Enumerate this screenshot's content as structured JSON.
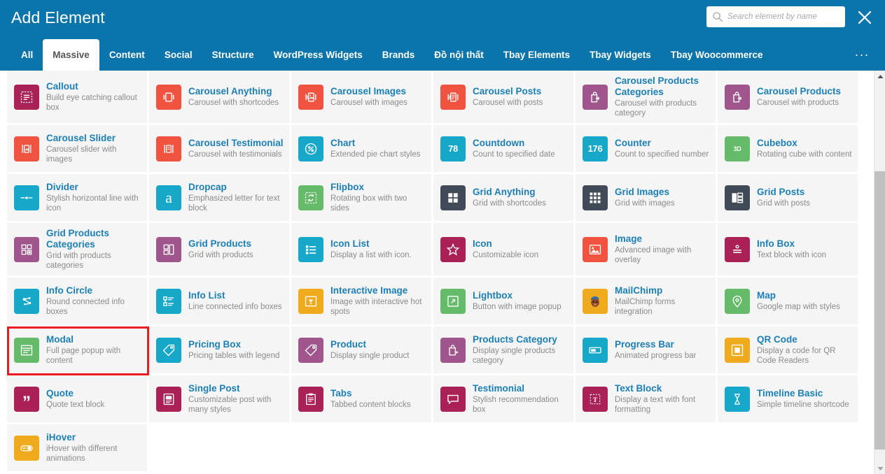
{
  "header": {
    "title": "Add Element",
    "search": {
      "placeholder": "Search element by name",
      "value": "",
      "icon": "search-icon"
    },
    "close_icon": "close-icon"
  },
  "tabs": {
    "items": [
      {
        "label": "All",
        "active": false
      },
      {
        "label": "Massive",
        "active": true
      },
      {
        "label": "Content",
        "active": false
      },
      {
        "label": "Social",
        "active": false
      },
      {
        "label": "Structure",
        "active": false
      },
      {
        "label": "WordPress Widgets",
        "active": false
      },
      {
        "label": "Brands",
        "active": false
      },
      {
        "label": "Đồ nội thất",
        "active": false
      },
      {
        "label": "Tbay Elements",
        "active": false
      },
      {
        "label": "Tbay Widgets",
        "active": false
      },
      {
        "label": "Tbay Woocommerce",
        "active": false
      }
    ],
    "more_label": "..."
  },
  "colors": {
    "header_blue": "#0a74ab",
    "title_blue": "#1c7fb5",
    "selection_red": "#ec1c24",
    "cell_bg": "#f5f5f5",
    "magenta": "#aa2255",
    "purple": "#a0558c",
    "red": "#f05340",
    "cyan": "#16a7c9",
    "green": "#66bb6a",
    "darkslate": "#414b57",
    "orange": "#efab1d"
  },
  "elements": [
    {
      "title": "Callout",
      "desc": "Build eye catching callout box",
      "icon": "callout-icon",
      "color": "#aa2255",
      "selected": false
    },
    {
      "title": "Carousel Anything",
      "desc": "Carousel with shortcodes",
      "icon": "carousel-anything-icon",
      "color": "#f05340",
      "selected": false
    },
    {
      "title": "Carousel Images",
      "desc": "Carousel with images",
      "icon": "carousel-images-icon",
      "color": "#f05340",
      "selected": false
    },
    {
      "title": "Carousel Posts",
      "desc": "Carousel with posts",
      "icon": "carousel-posts-icon",
      "color": "#f05340",
      "selected": false
    },
    {
      "title": "Carousel Products Categories",
      "desc": "Carousel with products category",
      "icon": "bag-arrow-icon",
      "color": "#a0558c",
      "selected": false
    },
    {
      "title": "Carousel Products",
      "desc": "Carousel with products",
      "icon": "bag-arrow-icon",
      "color": "#a0558c",
      "selected": false
    },
    {
      "title": "Carousel Slider",
      "desc": "Carousel slider with images",
      "icon": "carousel-slider-icon",
      "color": "#f05340",
      "selected": false
    },
    {
      "title": "Carousel Testimonial",
      "desc": "Carousel with testimonials",
      "icon": "carousel-testimonial-icon",
      "color": "#f05340",
      "selected": false
    },
    {
      "title": "Chart",
      "desc": "Extended pie chart styles",
      "icon": "pie-chart-icon",
      "color": "#16a7c9",
      "selected": false
    },
    {
      "title": "Countdown",
      "desc": "Count to specified date",
      "icon": "countdown-icon",
      "color": "#16a7c9",
      "badge": "78",
      "selected": false
    },
    {
      "title": "Counter",
      "desc": "Count to specified number",
      "icon": "counter-icon",
      "color": "#16a7c9",
      "badge": "176",
      "selected": false
    },
    {
      "title": "Cubebox",
      "desc": "Rotating cube with content",
      "icon": "cube-3d-icon",
      "color": "#66bb6a",
      "badge": "3D",
      "selected": false
    },
    {
      "title": "Divider",
      "desc": "Stylish horizontal line with icon",
      "icon": "divider-icon",
      "color": "#16a7c9",
      "selected": false
    },
    {
      "title": "Dropcap",
      "desc": "Emphasized letter for text block",
      "icon": "dropcap-icon",
      "color": "#16a7c9",
      "badge": "a",
      "selected": false
    },
    {
      "title": "Flipbox",
      "desc": "Rotating box with two sides",
      "icon": "flipbox-icon",
      "color": "#66bb6a",
      "selected": false
    },
    {
      "title": "Grid Anything",
      "desc": "Grid with shortcodes",
      "icon": "grid-anything-icon",
      "color": "#414b57",
      "selected": false
    },
    {
      "title": "Grid Images",
      "desc": "Grid with images",
      "icon": "grid-images-icon",
      "color": "#414b57",
      "selected": false
    },
    {
      "title": "Grid Posts",
      "desc": "Grid with posts",
      "icon": "grid-posts-icon",
      "color": "#414b57",
      "selected": false
    },
    {
      "title": "Grid Products Categories",
      "desc": "Grid with products categories",
      "icon": "grid-products-categories-icon",
      "color": "#a0558c",
      "selected": false
    },
    {
      "title": "Grid Products",
      "desc": "Grid with products",
      "icon": "grid-products-icon",
      "color": "#a0558c",
      "selected": false
    },
    {
      "title": "Icon List",
      "desc": "Display a list with icon.",
      "icon": "icon-list-icon",
      "color": "#16a7c9",
      "selected": false
    },
    {
      "title": "Icon",
      "desc": "Customizable icon",
      "icon": "star-icon",
      "color": "#aa2255",
      "selected": false
    },
    {
      "title": "Image",
      "desc": "Advanced image with overlay",
      "icon": "image-icon",
      "color": "#f05340",
      "selected": false
    },
    {
      "title": "Info Box",
      "desc": "Text block with icon",
      "icon": "info-box-icon",
      "color": "#aa2255",
      "selected": false
    },
    {
      "title": "Info Circle",
      "desc": "Round connected info boxes",
      "icon": "info-circle-icon",
      "color": "#16a7c9",
      "selected": false
    },
    {
      "title": "Info List",
      "desc": "Line connected info boxes",
      "icon": "info-list-icon",
      "color": "#16a7c9",
      "selected": false
    },
    {
      "title": "Interactive Image",
      "desc": "Image with interactive hot spots",
      "icon": "interactive-image-icon",
      "color": "#efab1d",
      "selected": false
    },
    {
      "title": "Lightbox",
      "desc": "Button with image popup",
      "icon": "lightbox-expand-icon",
      "color": "#66bb6a",
      "selected": false
    },
    {
      "title": "MailChimp",
      "desc": "MailChimp forms integration",
      "icon": "mailchimp-monkey-icon",
      "color": "#efab1d",
      "selected": false
    },
    {
      "title": "Map",
      "desc": "Google map with styles",
      "icon": "map-pin-icon",
      "color": "#66bb6a",
      "selected": false
    },
    {
      "title": "Modal",
      "desc": "Full page popup with content",
      "icon": "modal-icon",
      "color": "#66bb6a",
      "selected": true
    },
    {
      "title": "Pricing Box",
      "desc": "Pricing tables with legend",
      "icon": "price-tag-icon",
      "color": "#16a7c9",
      "selected": false
    },
    {
      "title": "Product",
      "desc": "Display single product",
      "icon": "price-tag-icon",
      "color": "#a0558c",
      "selected": false
    },
    {
      "title": "Products Category",
      "desc": "Display single products category",
      "icon": "bag-plus-icon",
      "color": "#a0558c",
      "selected": false
    },
    {
      "title": "Progress Bar",
      "desc": "Animated progress bar",
      "icon": "progress-bar-icon",
      "color": "#16a7c9",
      "selected": false
    },
    {
      "title": "QR Code",
      "desc": "Display a code for QR Code Readers",
      "icon": "qr-code-icon",
      "color": "#efab1d",
      "selected": false
    },
    {
      "title": "Quote",
      "desc": "Quote text block",
      "icon": "quote-icon",
      "color": "#aa2255",
      "badge": "”",
      "selected": false
    },
    {
      "title": "Single Post",
      "desc": "Customizable post with many styles",
      "icon": "single-post-icon",
      "color": "#aa2255",
      "selected": false
    },
    {
      "title": "Tabs",
      "desc": "Tabbed content blocks",
      "icon": "tabs-icon",
      "color": "#aa2255",
      "selected": false
    },
    {
      "title": "Testimonial",
      "desc": "Stylish recommendation box",
      "icon": "speech-bubble-icon",
      "color": "#aa2255",
      "selected": false
    },
    {
      "title": "Text Block",
      "desc": "Display a text with font formatting",
      "icon": "text-block-icon",
      "color": "#aa2255",
      "badge": "T",
      "selected": false
    },
    {
      "title": "Timeline Basic",
      "desc": "Simple timeline shortcode",
      "icon": "hourglass-icon",
      "color": "#16a7c9",
      "selected": false
    },
    {
      "title": "iHover",
      "desc": "iHover with different animations",
      "icon": "ihover-icon",
      "color": "#efab1d",
      "selected": false
    }
  ],
  "scrollbar": {
    "up_icon": "triangle-up-icon",
    "down_icon": "triangle-down-icon"
  }
}
